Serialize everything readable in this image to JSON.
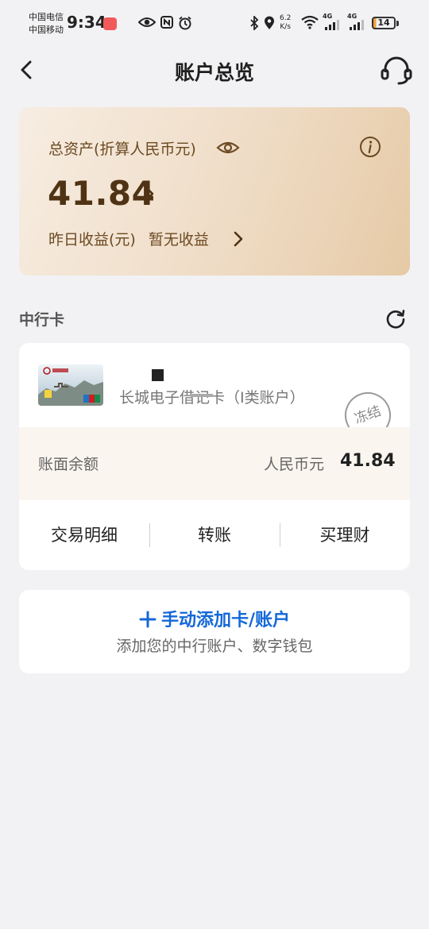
{
  "status_bar": {
    "carrier_1": "中国电信",
    "carrier_2": "中国移动",
    "time": "9:34",
    "net_speed_value": "6.2",
    "net_speed_unit": "K/s",
    "signal_tag_1": "4G",
    "signal_tag_2": "4G",
    "battery_level": "14",
    "icons": [
      "eye-icon",
      "nfc-icon",
      "alarm-icon",
      "bluetooth-icon",
      "location-icon",
      "wifi-icon",
      "signal-icon",
      "signal-icon",
      "battery-icon"
    ]
  },
  "header": {
    "title": "账户总览",
    "back_icon": "chevron-left-icon",
    "support_icon": "headset-icon"
  },
  "assets": {
    "label": "总资产(折算人民币元)",
    "value": "41.84",
    "yield_label": "昨日收益(元)",
    "yield_value": "暂无收益"
  },
  "section": {
    "title": "中行卡"
  },
  "account": {
    "card_name": "长城电子借记卡（I类账户）",
    "status_stamp": "冻结",
    "balance_label": "账面余额",
    "balance_currency": "人民币元",
    "balance_amount": "41.84",
    "actions": [
      "交易明细",
      "转账",
      "买理财"
    ]
  },
  "add_account": {
    "title": "手动添加卡/账户",
    "subtitle": "添加您的中行账户、数字钱包"
  },
  "colors": {
    "accent_blue": "#1468d8",
    "asset_card_text": "#6b4a22",
    "asset_value": "#4f3314",
    "page_bg": "#f2f2f4"
  }
}
